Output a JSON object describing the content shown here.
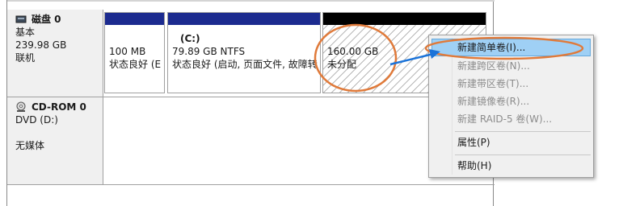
{
  "disks": [
    {
      "name": "磁盘 0",
      "type": "基本",
      "size": "239.98 GB",
      "status": "联机",
      "icon": "hard-disk-icon",
      "partitions": [
        {
          "letter": "",
          "size_fs": "100 MB",
          "status": "状态良好 (E"
        },
        {
          "letter": "(C:)",
          "size_fs": "79.89 GB NTFS",
          "status": "状态良好 (启动, 页面文件, 故障转"
        },
        {
          "letter": "",
          "size_fs": "160.00 GB",
          "status": "未分配"
        }
      ]
    },
    {
      "name": "CD-ROM 0",
      "type": "DVD (D:)",
      "media": "无媒体",
      "icon": "cd-rom-icon"
    }
  ],
  "context_menu": {
    "items": [
      {
        "label": "新建简单卷(I)...",
        "enabled": true,
        "highlighted": true
      },
      {
        "label": "新建跨区卷(N)...",
        "enabled": false
      },
      {
        "label": "新建带区卷(T)...",
        "enabled": false
      },
      {
        "label": "新建镜像卷(R)...",
        "enabled": false
      },
      {
        "label": "新建 RAID-5 卷(W)...",
        "enabled": false
      },
      {
        "label": "属性(P)",
        "enabled": true
      },
      {
        "label": "帮助(H)",
        "enabled": true
      }
    ]
  },
  "colors": {
    "primary_partition_bar": "#1c2b8f",
    "unallocated_bar": "#000000",
    "menu_highlight": "#9fd0f5",
    "annotation": "#e07a3a",
    "arrow": "#1a73d9"
  }
}
